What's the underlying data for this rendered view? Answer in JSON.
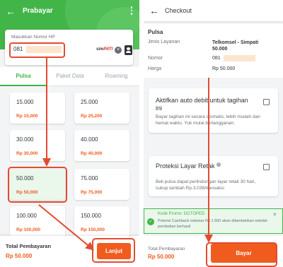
{
  "left_screen": {
    "title": "Prabayar",
    "phone": {
      "label": "Masukkan Nomor HP",
      "value": "081",
      "operator_brand": "sim",
      "operator_name": "PATI"
    },
    "tabs": [
      {
        "label": "Pulsa",
        "active": true
      },
      {
        "label": "Paket Data",
        "active": false
      },
      {
        "label": "Roaming",
        "active": false
      }
    ],
    "products": [
      {
        "nominal": "15.000",
        "price": "Rp 15,000"
      },
      {
        "nominal": "25.000",
        "price": "Rp 25,200"
      },
      {
        "nominal": "30.000",
        "price": "Rp 30,000"
      },
      {
        "nominal": "40.000",
        "price": "Rp 40,000"
      },
      {
        "nominal": "50.000",
        "price": "Rp 50,000"
      },
      {
        "nominal": "75.000",
        "price": "Rp 75,000"
      },
      {
        "nominal": "100.000",
        "price": "Rp 100,000"
      },
      {
        "nominal": "150.000",
        "price": "Rp 150,000"
      }
    ],
    "footer": {
      "total_label": "Total Pembayaran",
      "total_value": "Rp 50.000",
      "button_label": "Lanjut"
    }
  },
  "right_screen": {
    "title": "Checkout",
    "section_title": "Pulsa",
    "rows": [
      {
        "label": "Jenis Layanan",
        "value": "Telkomsel - Simpati 50.000"
      },
      {
        "label": "Nomor",
        "value": "081"
      },
      {
        "label": "Harga",
        "value": "Rp 50.000"
      }
    ],
    "auto_debit": {
      "title": "Aktifkan auto debit untuk tagihan ini",
      "description": "Bayar tagihan ini secara otomatis, lebih mudah dan hemat waktu. Yuk mulai berlangganan."
    },
    "screen_protection": {
      "title": "Proteksi Layar Retak",
      "info_icon": "i",
      "description": "Beli pulsa dapat perlindungan layar retak 30 hari, cukup tambah Rp.3.038/transaksi"
    },
    "promo": {
      "code_text": "Kode Promo: DGTOPED",
      "message": "Potensi Cashback sebesar Rp 1.500 akan ditambahkan setelah pembelian berhasil"
    },
    "footer": {
      "total_label": "Total Pembayaran",
      "total_value": "Rp 50.000",
      "button_label": "Bayar"
    }
  },
  "colors": {
    "brand_green": "#42b549",
    "cta_orange": "#f05c1e",
    "annotation_red": "#e24b31"
  }
}
